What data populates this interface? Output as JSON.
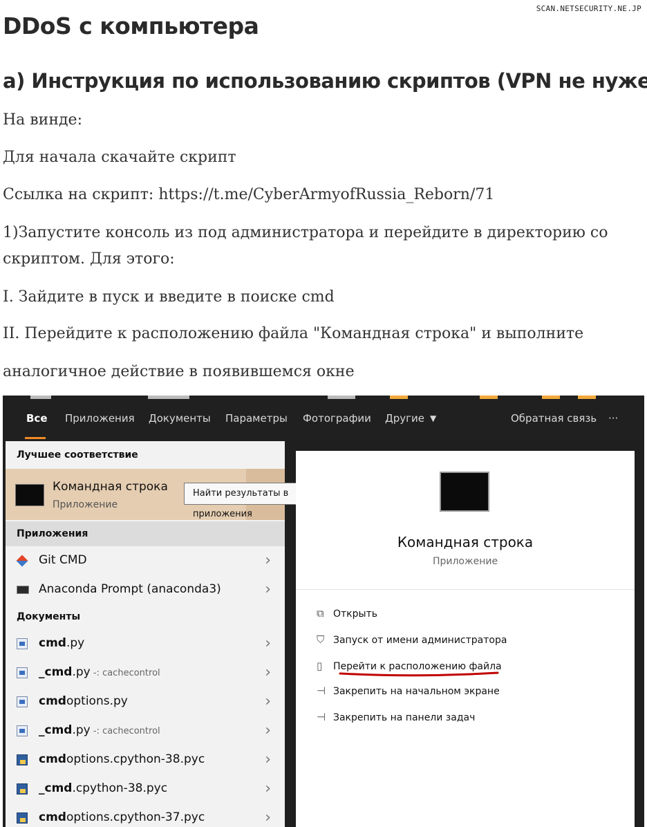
{
  "watermark": "SCAN.NETSECURITY.NE.JP",
  "article": {
    "title": "DDoS с компьютера",
    "subtitle": "а) Инструкция по использованию скриптов (VPN не нужен)",
    "paragraphs": [
      "На винде:",
      "Для начала скачайте скрипт",
      "Ссылка на скрипт: https://t.me/CyberArmyofRussia_Reborn/71",
      "1)Запустите консоль из под администратора и перейдите в директорию со скриптом. Для этого:",
      "I. Зайдите в пуск и введите в поиске cmd",
      "II. Перейдите к расположению файла \"Командная строка\" и выполните",
      "аналогичное действие в появившемся окне"
    ]
  },
  "search_window": {
    "tabs": {
      "all": "Все",
      "apps": "Приложения",
      "docs": "Документы",
      "settings": "Параметры",
      "photos": "Фотографии",
      "other": "Другие",
      "feedback": "Обратная связь",
      "more": "···"
    },
    "best_match_header": "Лучшее соответствие",
    "best_match": {
      "name": "Командная строка",
      "type": "Приложение"
    },
    "tooltip": "Найти результаты в приложения",
    "apps_header": "Приложения",
    "apps": [
      {
        "name": "Git CMD"
      },
      {
        "name": "Anaconda Prompt (anaconda3)"
      }
    ],
    "docs_header": "Документы",
    "docs": [
      {
        "bold": "cmd",
        "rest": ".py",
        "sub": ""
      },
      {
        "bold": "_cmd",
        "rest": ".py",
        "sub": " -: cachecontrol"
      },
      {
        "bold": "cmd",
        "rest": "options.py",
        "sub": ""
      },
      {
        "bold": "_cmd",
        "rest": ".py",
        "sub": " -: cachecontrol"
      },
      {
        "bold": "cmd",
        "rest": "options.cpython-38.pyc",
        "sub": ""
      },
      {
        "bold": "_cmd",
        "rest": ".cpython-38.pyc",
        "sub": ""
      },
      {
        "bold": "cmd",
        "rest": "options.cpython-37.pyc",
        "sub": ""
      }
    ],
    "preview": {
      "name": "Командная строка",
      "type": "Приложение",
      "actions": [
        "Открыть",
        "Запуск от имени администратора",
        "Перейти к расположению файла",
        "Закрепить на начальном экране",
        "Закрепить на панели задач"
      ]
    },
    "colors": {
      "accent": "#f08a24",
      "best_match_bg": "#e5cdb1",
      "underline": "#c00000"
    }
  }
}
